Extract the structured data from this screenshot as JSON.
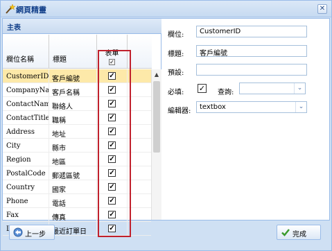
{
  "window": {
    "title": "網頁精靈",
    "close_glyph": "✕"
  },
  "grid": {
    "panel_title": "主表",
    "columns": {
      "field": "欄位名稱",
      "title": "標題",
      "form": "表單"
    },
    "header_check": "✓",
    "scroll_up": "▲",
    "rows": [
      {
        "field": "CustomerID",
        "title": "客戶編號",
        "checked": "✓"
      },
      {
        "field": "CompanyName",
        "title": "客戶名稱",
        "checked": "✓"
      },
      {
        "field": "ContactName",
        "title": "聯絡人",
        "checked": "✓"
      },
      {
        "field": "ContactTitle",
        "title": "職稱",
        "checked": "✓"
      },
      {
        "field": "Address",
        "title": "地址",
        "checked": "✓"
      },
      {
        "field": "City",
        "title": "縣市",
        "checked": "✓"
      },
      {
        "field": "Region",
        "title": "地區",
        "checked": "✓"
      },
      {
        "field": "PostalCode",
        "title": "郵遞區號",
        "checked": "✓"
      },
      {
        "field": "Country",
        "title": "國家",
        "checked": "✓"
      },
      {
        "field": "Phone",
        "title": "電話",
        "checked": "✓"
      },
      {
        "field": "Fax",
        "title": "傳真",
        "checked": "✓"
      },
      {
        "field": "LastOrderedDate",
        "title": "最近訂單日",
        "checked": "✓"
      }
    ]
  },
  "form": {
    "field_label": "欄位:",
    "field_value": "CustomerID",
    "title_label": "標題:",
    "title_value": "客戶編號",
    "default_label": "預設:",
    "default_value": "",
    "required_label": "必填:",
    "required_check": "✓",
    "query_label": "查詢:",
    "query_value": "",
    "editor_label": "編輯器:",
    "editor_value": "textbox",
    "dropdown_glyph": "⌄"
  },
  "footer": {
    "back_label": "上一步",
    "finish_label": "完成"
  },
  "colors": {
    "accent": "#99bbe8",
    "selected_row": "#fde9a9",
    "highlight_box": "#c0202c"
  }
}
